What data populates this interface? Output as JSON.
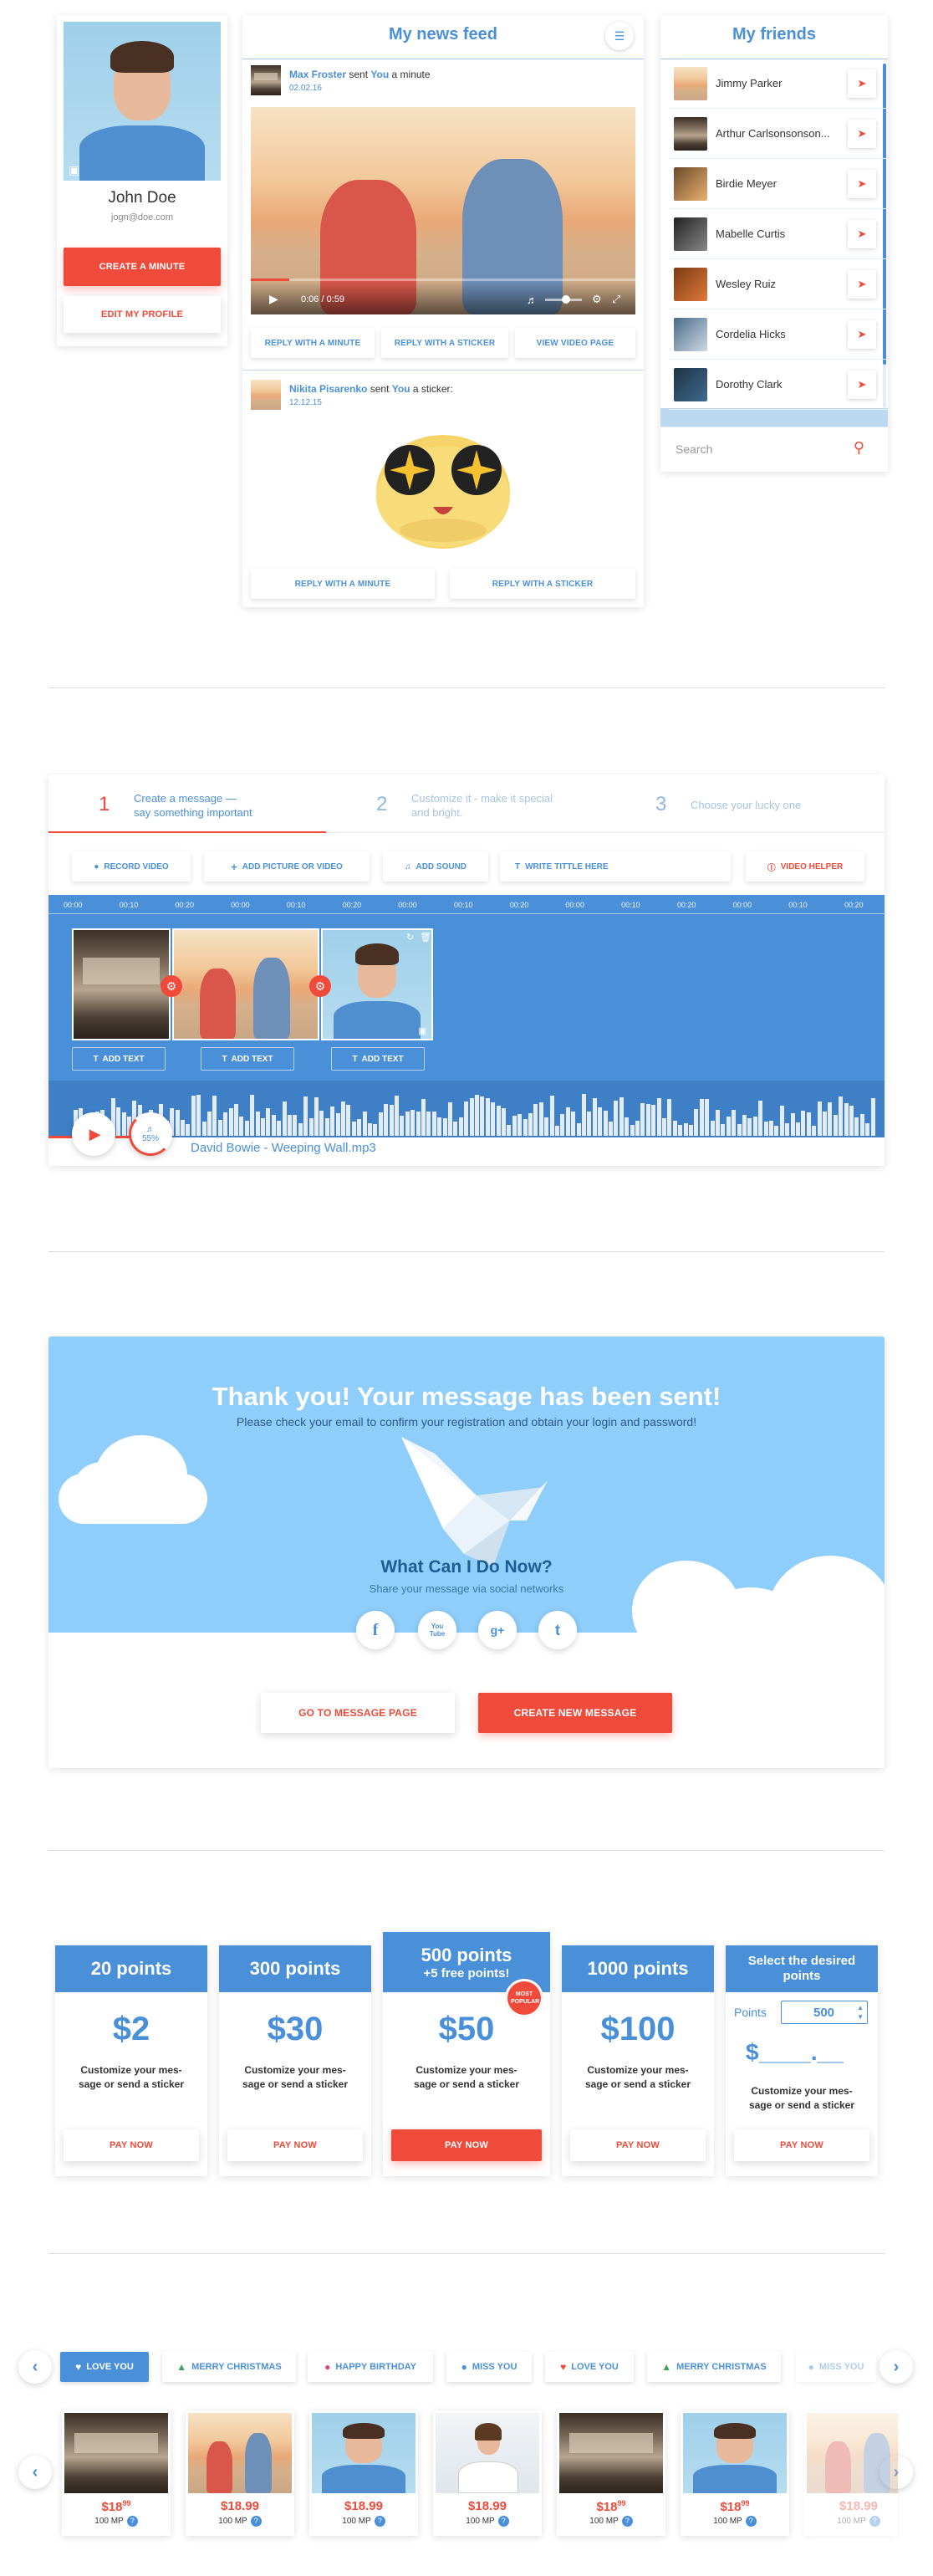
{
  "profile": {
    "name": "John Doe",
    "email": "jogn@doe.com",
    "create_label": "CREATE A MINUTE",
    "edit_label": "EDIT MY PROFILE"
  },
  "feed": {
    "title": "My news feed",
    "post1": {
      "sender": "Max Froster",
      "verb": "sent",
      "target": "You",
      "object": "a minute",
      "date": "02.02.16",
      "time": "0:06 / 0:59",
      "buttons": [
        "REPLY WITH A MINUTE",
        "REPLY WITH A STICKER",
        "VIEW VIDEO PAGE"
      ]
    },
    "post2": {
      "sender": "Nikita Pisarenko",
      "verb": "sent",
      "target": "You",
      "object": "a sticker:",
      "date": "12.12.15",
      "buttons": [
        "REPLY WITH A MINUTE",
        "REPLY WITH A STICKER"
      ]
    }
  },
  "friends": {
    "title": "My friends",
    "list": [
      "Jimmy Parker",
      "Arthur Carlsonsonson...",
      "Birdie Meyer",
      "Mabelle Curtis",
      "Wesley Ruiz",
      "Cordelia Hicks",
      "Dorothy Clark"
    ],
    "search_placeholder": "Search"
  },
  "editor": {
    "steps": [
      {
        "num": "1",
        "text": "Create a message —\nsay something important"
      },
      {
        "num": "2",
        "text": "Customize it - make it special\nand bright."
      },
      {
        "num": "3",
        "text": "Choose your lucky one"
      }
    ],
    "tools": [
      "RECORD VIDEO",
      "ADD PICTURE OR VIDEO",
      "ADD SOUND",
      "WRITE TITTLE HERE",
      "VIDEO HELPER"
    ],
    "ticks": [
      "00:00",
      "00:10",
      "00:20",
      "00:00",
      "00:10",
      "00:20",
      "00:00",
      "00:10",
      "00:20",
      "00:00",
      "00:10",
      "00:20",
      "00:00",
      "00:10",
      "00:20"
    ],
    "add_text": "ADD TEXT",
    "volume": "55%",
    "track": "David Bowie - Weeping Wall.mp3"
  },
  "sent": {
    "title": "Thank you! Your message has been sent!",
    "subtitle": "Please check your email to confirm your registration and obtain your login and password!",
    "question": "What Can I Do Now?",
    "share_text": "Share your message via social networks",
    "social": [
      "f",
      "You\nTube",
      "g+",
      "t"
    ],
    "go_label": "GO TO MESSAGE PAGE",
    "new_label": "CREATE NEW MESSAGE"
  },
  "pricing": {
    "plans": [
      {
        "title": "20 points",
        "sub": "",
        "price": "$2"
      },
      {
        "title": "300 points",
        "sub": "",
        "price": "$30"
      },
      {
        "title": "500 points",
        "sub": "+5 free points!",
        "price": "$50"
      },
      {
        "title": "1000 points",
        "sub": "",
        "price": "$100"
      }
    ],
    "desc": "Customize your mes-\nsage or send a sticker",
    "badge": "MOST POPULAR",
    "pay": "PAY NOW",
    "custom_title": "Select the desired\npoints",
    "points_label": "Points",
    "points_value": "500",
    "custom_price": "$____.__"
  },
  "shop": {
    "tags": [
      {
        "icon": "heart",
        "label": "LOVE YOU"
      },
      {
        "icon": "tree",
        "label": "MERRY CHRISTMAS"
      },
      {
        "icon": "balloon",
        "label": "HAPPY BIRTHDAY"
      },
      {
        "icon": "drop",
        "label": "MISS YOU"
      },
      {
        "icon": "heart",
        "label": "LOVE YOU"
      },
      {
        "icon": "tree",
        "label": "MERRY CHRISTMAS"
      },
      {
        "icon": "drop",
        "label": "MISS YOU"
      }
    ],
    "price": "$18",
    "price_sup": "99",
    "mp": "100 MP"
  }
}
